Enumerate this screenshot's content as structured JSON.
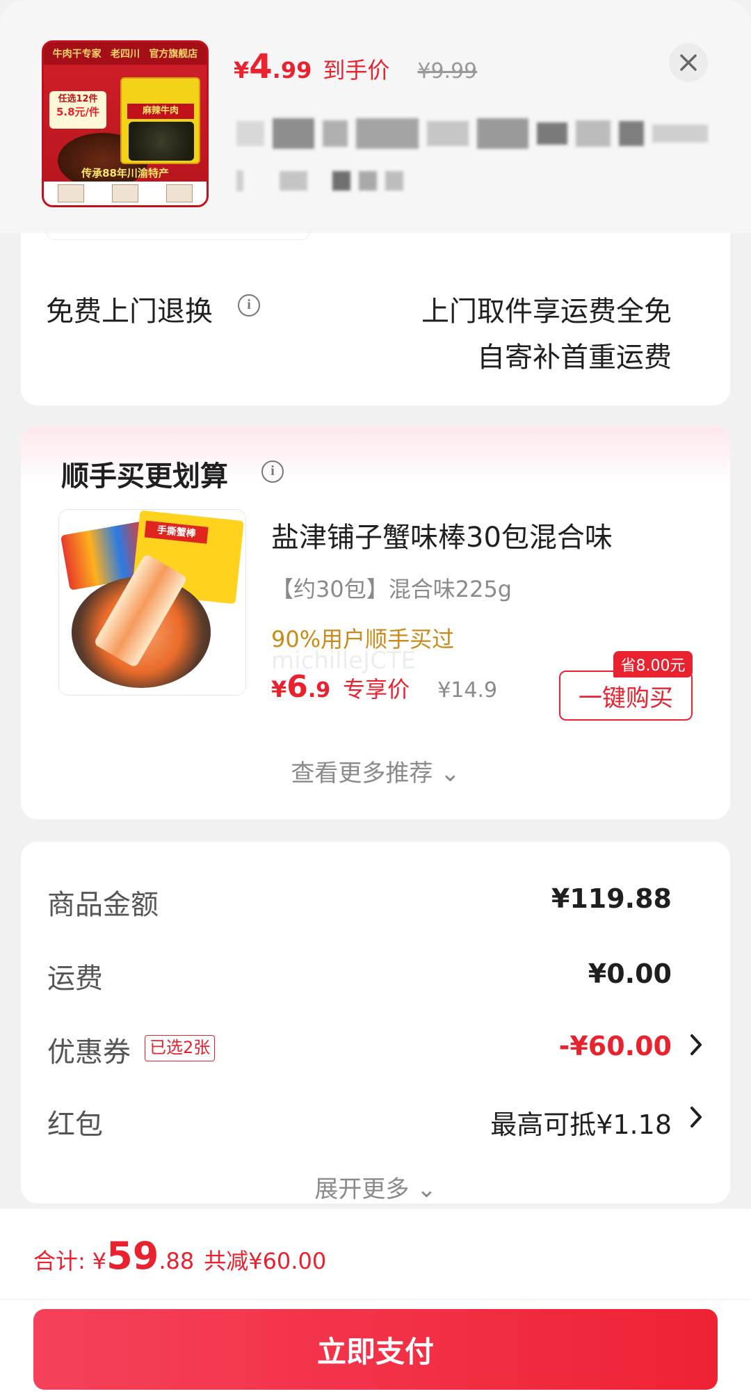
{
  "header": {
    "price_yen": "¥",
    "price_int": "4",
    "price_dec": ".99",
    "price_tag": "到手价",
    "orig_price": "¥9.99",
    "thumb": {
      "top_left": "牛肉干专家",
      "brand": "老四川",
      "top_right": "官方旗舰店",
      "pick_line1": "任选12件",
      "pick_line2": "5.8元/件",
      "pack_label": "麻辣牛肉",
      "banner": "传承88年川渝特产"
    }
  },
  "returns": {
    "label": "免费上门退换",
    "line1": "上门取件享运费全免",
    "line2": "自寄补首重运费"
  },
  "recommend": {
    "title": "顺手买更划算",
    "product_name": "盐津铺子蟹味棒30包混合味",
    "spec": "【约30包】混合味225g",
    "bought_pct": "90%用户顺手买过",
    "watermark": "michilleJCTE",
    "price_yen": "¥",
    "price_int": "6",
    "price_dec": ".9",
    "price_tag": "专享价",
    "orig_price": "¥14.9",
    "bag_label": "手撕蟹棒",
    "save_badge": "省8.00元",
    "buy_label": "一键购买",
    "more_label": "查看更多推荐 ⌄"
  },
  "fees": {
    "goods_label": "商品金额",
    "goods_value": "¥119.88",
    "shipping_label": "运费",
    "shipping_value": "¥0.00",
    "coupon_label": "优惠券",
    "coupon_tag": "已选2张",
    "coupon_value": "-¥60.00",
    "redpacket_label": "红包",
    "redpacket_value": "最高可抵¥1.18",
    "expand_label": "展开更多 ⌄"
  },
  "bottom": {
    "total_label": "合计:",
    "total_yen": "¥",
    "total_int": "59",
    "total_dec": ".88",
    "total_save": "共减¥60.00",
    "pay_label": "立即支付"
  },
  "icons": {
    "close": "close-icon",
    "info": "info-icon",
    "chevron": "chevron-right-icon"
  },
  "colors": {
    "accent": "#e8222f",
    "gold": "#c98a19"
  }
}
